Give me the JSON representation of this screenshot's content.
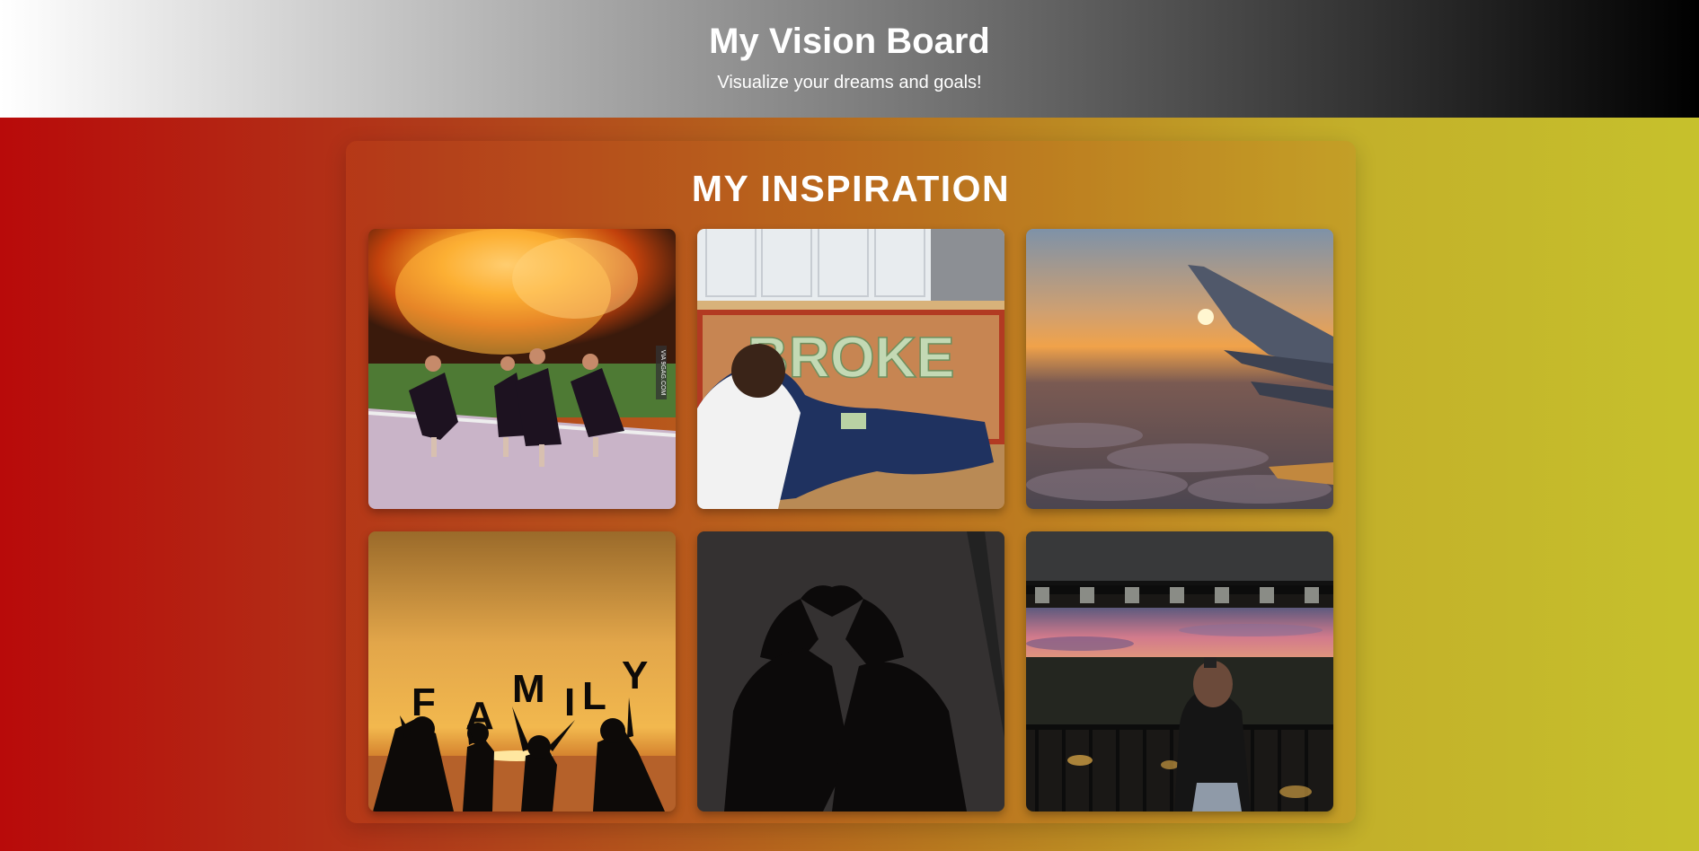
{
  "header": {
    "title": "My Vision Board",
    "subtitle": "Visualize your dreams and goals!"
  },
  "board": {
    "heading": "MY INSPIRATION",
    "images": [
      {
        "name": "graduates-explosion-photo",
        "watermark": "VIA 9GAG.COM"
      },
      {
        "name": "money-broke-photo",
        "word": "BROKE"
      },
      {
        "name": "airplane-sunset-photo"
      },
      {
        "name": "family-sunset-photo",
        "letters": [
          "F",
          "A",
          "M",
          "I",
          "L",
          "Y"
        ]
      },
      {
        "name": "shadow-heart-photo"
      },
      {
        "name": "balcony-sunset-photo"
      }
    ]
  },
  "colors": {
    "header_gradient": [
      "#ffffff",
      "#000000"
    ],
    "page_gradient": [
      "#b80a0a",
      "#c6c12c"
    ]
  }
}
